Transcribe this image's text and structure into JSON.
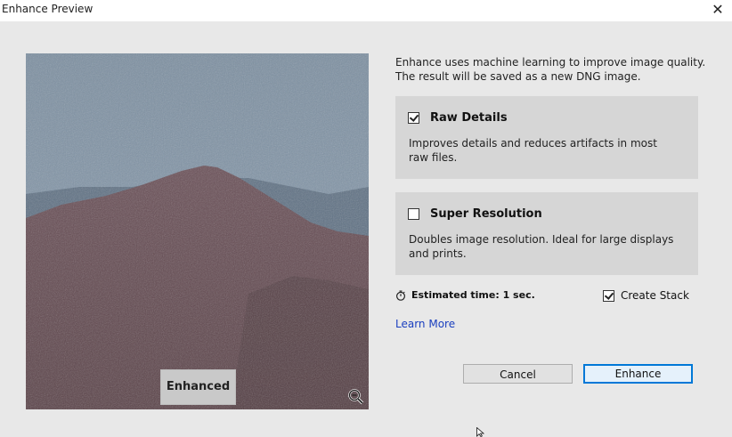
{
  "window": {
    "title": "Enhance Preview",
    "close_glyph": "✕"
  },
  "preview": {
    "overlay_label": "Enhanced",
    "zoom_icon": "zoom-out-icon"
  },
  "description": "Enhance uses machine learning to improve image quality. The result will be saved as a new DNG image.",
  "options": [
    {
      "label": "Raw Details",
      "checked": true,
      "description": "Improves details and reduces artifacts in most raw files."
    },
    {
      "label": "Super Resolution",
      "checked": false,
      "description": "Doubles image resolution. Ideal for large displays and prints."
    }
  ],
  "estimated_time": "Estimated time: 1 sec.",
  "create_stack": {
    "label": "Create Stack",
    "checked": true
  },
  "learn_more": "Learn More",
  "buttons": {
    "cancel": "Cancel",
    "enhance": "Enhance"
  },
  "colors": {
    "accent": "#0078d7",
    "link": "#1a3fbf",
    "card": "#d6d6d6"
  }
}
